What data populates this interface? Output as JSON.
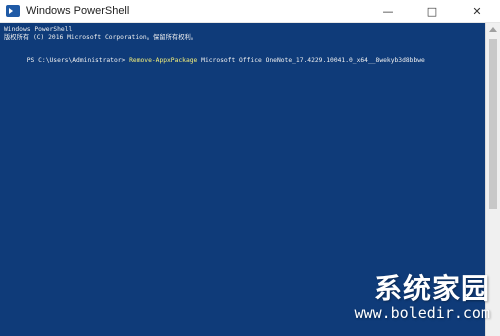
{
  "window": {
    "title": "Windows PowerShell",
    "controls": {
      "minimize": "—",
      "maximize": "□",
      "close": "✕"
    }
  },
  "console": {
    "header_line_1": "Windows PowerShell",
    "header_line_2": "版权所有 (C) 2016 Microsoft Corporation。保留所有权利。",
    "prompt": "PS C:\\Users\\Administrator> ",
    "command": "Remove-AppxPackage",
    "argument": " Microsoft Office OneNote_17.4229.10041.0_x64__8wekyb3d8bbwe"
  },
  "watermark": {
    "title": "系统家园",
    "url": "www.boledir.com"
  },
  "icons": {
    "app": "powershell-icon",
    "minimize": "minimize-icon",
    "maximize": "maximize-icon",
    "close": "close-icon"
  },
  "colors": {
    "console_background": "#0f3b79",
    "console_text": "#f1f1f1",
    "command_text": "#f5f07a"
  }
}
